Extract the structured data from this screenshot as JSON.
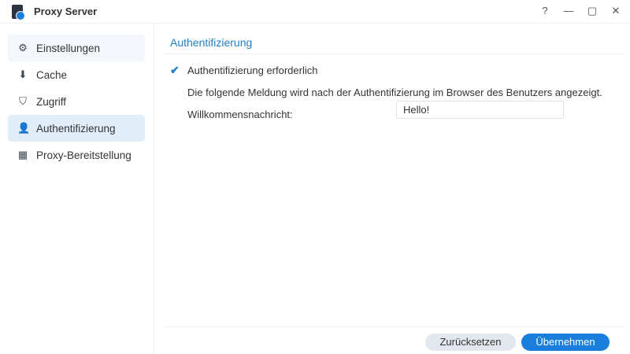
{
  "window": {
    "title": "Proxy Server",
    "controls": [
      "?",
      "—",
      "▢",
      "✕"
    ]
  },
  "sidebar": {
    "items": [
      {
        "label": "Einstellungen",
        "icon": "gear-icon"
      },
      {
        "label": "Cache",
        "icon": "cache-icon"
      },
      {
        "label": "Zugriff",
        "icon": "shield-icon"
      },
      {
        "label": "Authentifizierung",
        "icon": "user-icon"
      },
      {
        "label": "Proxy-Bereitstellung",
        "icon": "router-icon"
      }
    ]
  },
  "main": {
    "section_title": "Authentifizierung",
    "checkbox_label": "Authentifizierung erforderlich",
    "checkbox_checked": true,
    "description": "Die folgende Meldung wird nach der Authentifizierung im Browser des Benutzers angezeigt.",
    "welcome_label": "Willkommensnachricht:",
    "welcome_value": "Hello!"
  },
  "footer": {
    "reset": "Zurücksetzen",
    "apply": "Übernehmen"
  },
  "colors": {
    "accent": "#1a7fdc",
    "active_bg": "#e1eef9"
  }
}
